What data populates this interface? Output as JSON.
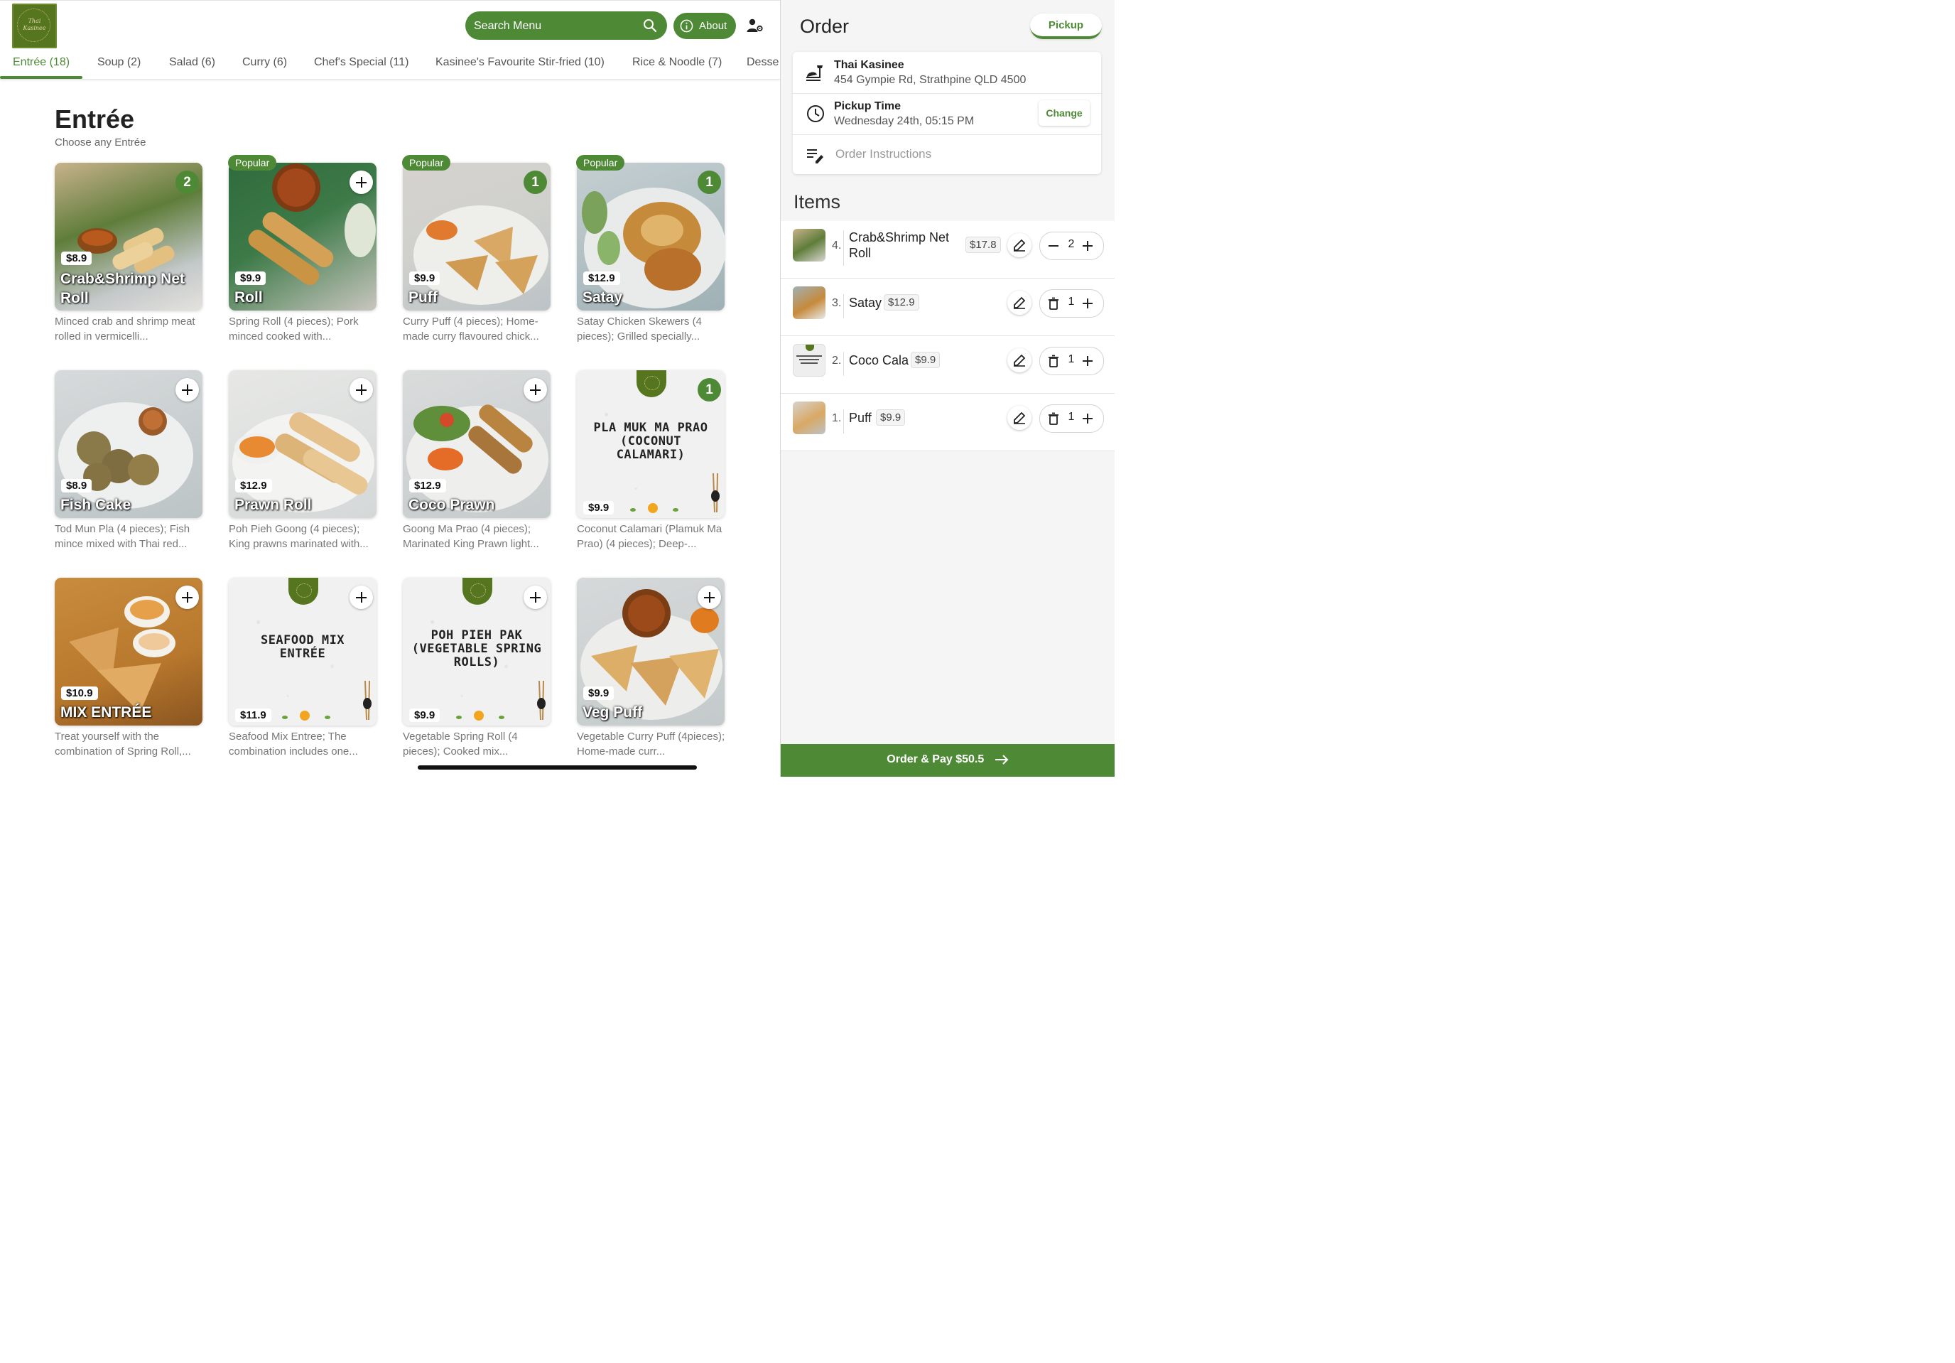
{
  "brand": {
    "logo_text": "Thai\nKasinee",
    "accent": "#4e8a36"
  },
  "header": {
    "search_placeholder": "Search Menu",
    "about_label": "About"
  },
  "tabs": [
    {
      "label": "Entrée (18)"
    },
    {
      "label": "Soup (2)"
    },
    {
      "label": "Salad (6)"
    },
    {
      "label": "Curry (6)"
    },
    {
      "label": "Chef's Special (11)"
    },
    {
      "label": "Kasinee's Favourite Stir-fried (10)"
    },
    {
      "label": "Rice & Noodle (7)"
    },
    {
      "label": "Desse"
    }
  ],
  "section": {
    "title": "Entrée",
    "subtitle": "Choose any Entrée"
  },
  "items": [
    {
      "name": "Crab&Shrimp Net Roll",
      "price": "$8.9",
      "desc": "Minced crab and shrimp meat rolled in vermicelli...",
      "popular": false,
      "count": "2",
      "popular_label": ""
    },
    {
      "name": "Roll",
      "price": "$9.9",
      "desc": "Spring Roll (4 pieces); Pork minced cooked with...",
      "popular": true,
      "count": "",
      "popular_label": "Popular"
    },
    {
      "name": "Puff",
      "price": "$9.9",
      "desc": "Curry Puff (4 pieces); Home-made curry flavoured chick...",
      "popular": true,
      "count": "1",
      "popular_label": "Popular"
    },
    {
      "name": "Satay",
      "price": "$12.9",
      "desc": "Satay Chicken Skewers (4 pieces); Grilled specially...",
      "popular": true,
      "count": "1",
      "popular_label": "Popular"
    },
    {
      "name": "Fish Cake",
      "price": "$8.9",
      "desc": "Tod Mun Pla (4 pieces); Fish mince mixed with Thai red...",
      "popular": false,
      "count": "",
      "popular_label": ""
    },
    {
      "name": "Prawn Roll",
      "price": "$12.9",
      "desc": "Poh Pieh Goong (4 pieces); King prawns marinated with...",
      "popular": false,
      "count": "",
      "popular_label": ""
    },
    {
      "name": "Coco Prawn",
      "price": "$12.9",
      "desc": "Goong Ma Prao (4 pieces); Marinated King Prawn light...",
      "popular": false,
      "count": "",
      "popular_label": ""
    },
    {
      "name": "PLA MUK MA PRAO (COCONUT CALAMARI)",
      "price": "$9.9",
      "desc": "Coconut Calamari (Plamuk Ma Prao) (4 pieces); Deep-...",
      "popular": false,
      "count": "1",
      "popular_label": ""
    },
    {
      "name": "MIX ENTRÉE",
      "price": "$10.9",
      "desc": "Treat yourself with the combination of Spring Roll,...",
      "popular": false,
      "count": "",
      "popular_label": ""
    },
    {
      "name": "SEAFOOD MIX ENTRÉE",
      "price": "$11.9",
      "desc": "Seafood Mix Entree; The combination includes one...",
      "popular": false,
      "count": "",
      "popular_label": ""
    },
    {
      "name": "POH PIEH PAK (VEGETABLE SPRING ROLLS)",
      "price": "$9.9",
      "desc": "Vegetable Spring Roll (4 pieces); Cooked mix...",
      "popular": false,
      "count": "",
      "popular_label": ""
    },
    {
      "name": "Veg Puff",
      "price": "$9.9",
      "desc": "Vegetable Curry Puff (4pieces); Home-made curr...",
      "popular": false,
      "count": "",
      "popular_label": ""
    }
  ],
  "order": {
    "title": "Order",
    "mode_label": "Pickup",
    "restaurant_name": "Thai Kasinee",
    "restaurant_address": "454 Gympie Rd, Strathpine QLD 4500",
    "pickup_title": "Pickup Time",
    "pickup_time": "Wednesday 24th, 05:15 PM",
    "change_label": "Change",
    "instructions_placeholder": "Order Instructions",
    "items_title": "Items",
    "lines": [
      {
        "num": "4.",
        "name_line1": "Crab&Shrimp Net",
        "name_line2": "Roll",
        "price": "$17.8",
        "qty": "2"
      },
      {
        "num": "3.",
        "name_line1": "Satay",
        "name_line2": "",
        "price": "$12.9",
        "qty": "1"
      },
      {
        "num": "2.",
        "name_line1": "Coco Cala",
        "name_line2": "",
        "price": "$9.9",
        "qty": "1"
      },
      {
        "num": "1.",
        "name_line1": "Puff",
        "name_line2": "",
        "price": "$9.9",
        "qty": "1"
      }
    ],
    "pay_label": "Order & Pay $50.5"
  }
}
